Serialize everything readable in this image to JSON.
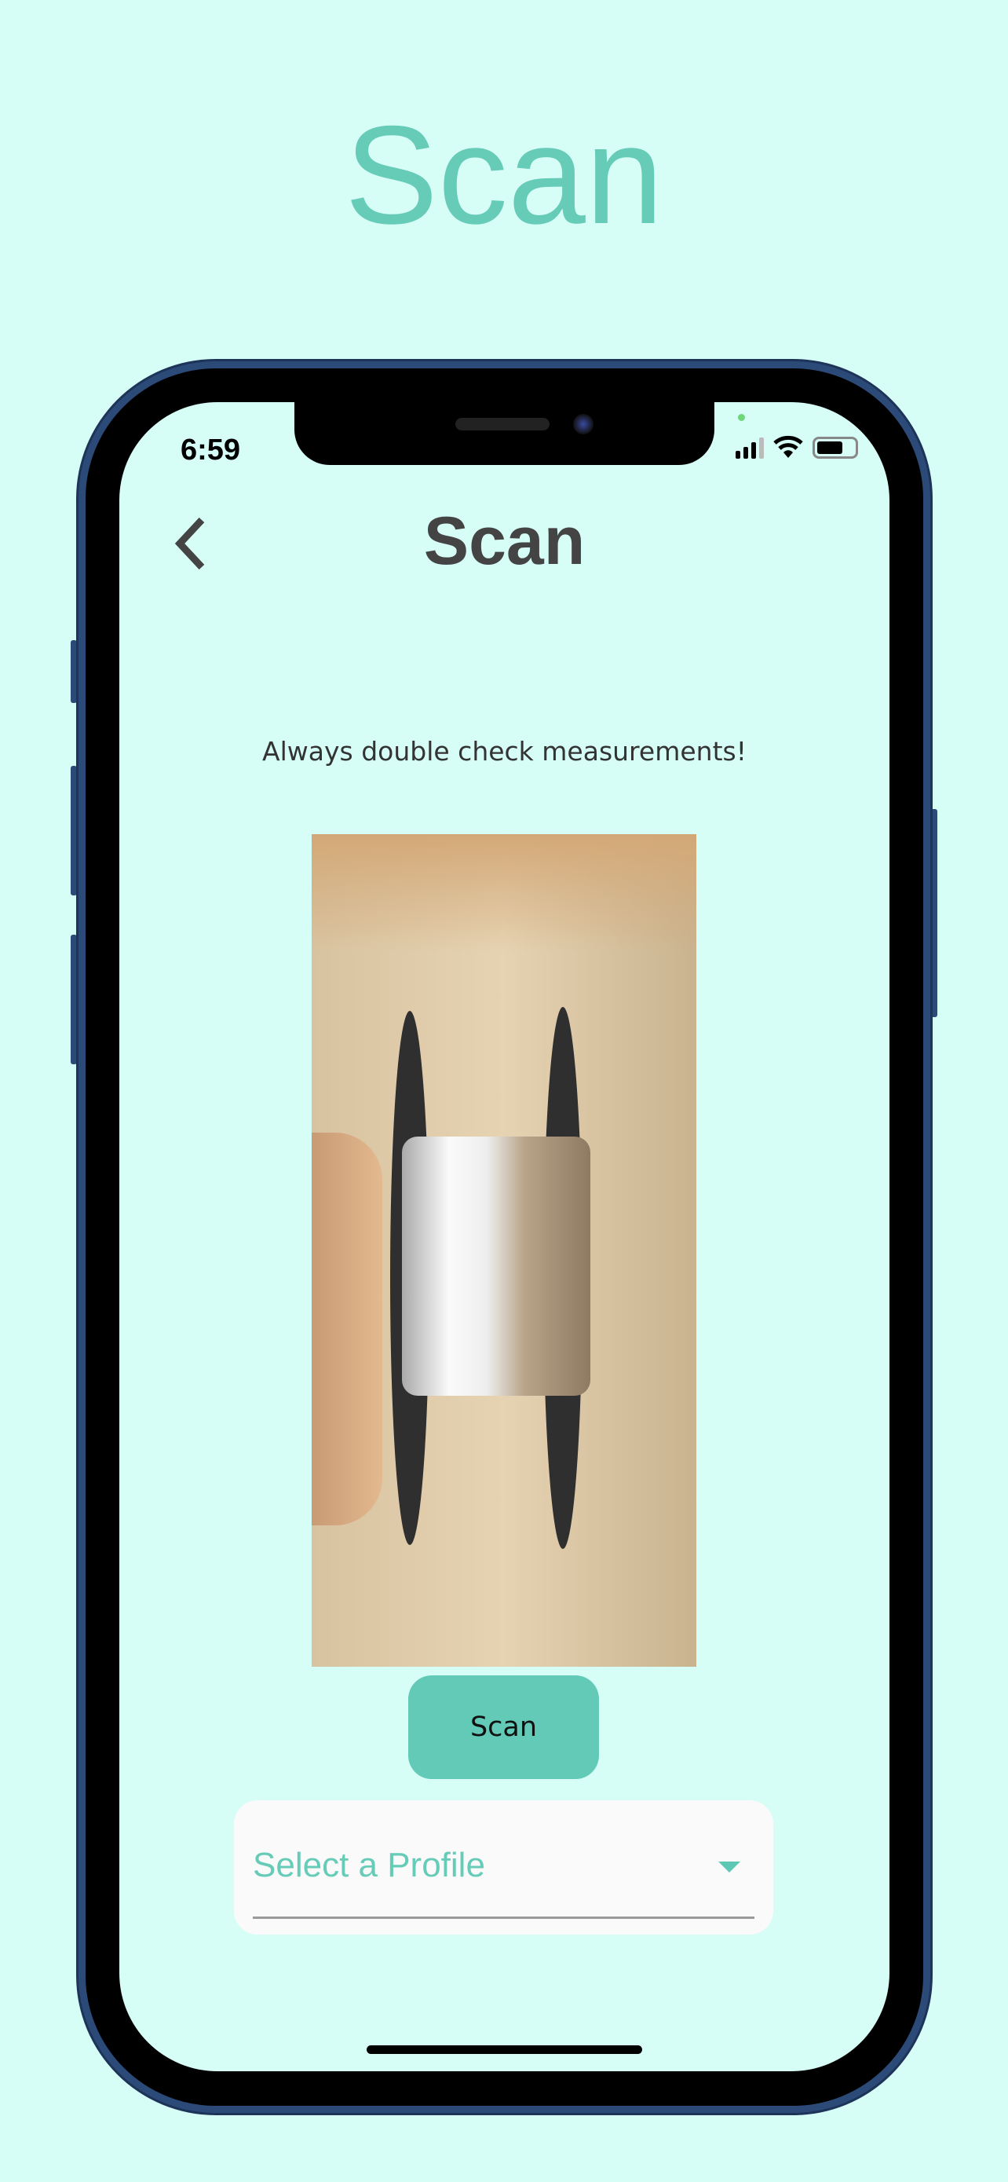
{
  "hero_title": "Scan",
  "status_bar": {
    "time": "6:59"
  },
  "header": {
    "title": "Scan",
    "back_icon": "chevron-left-icon"
  },
  "note": "Always double check measurements!",
  "scan_button": {
    "label": "Scan"
  },
  "profile_dropdown": {
    "placeholder": "Select a Profile",
    "icon": "caret-down-icon"
  },
  "colors": {
    "background": "#d6fdf6",
    "accent": "#63cab8",
    "title": "#444444",
    "bezel": "#2c4a78"
  }
}
